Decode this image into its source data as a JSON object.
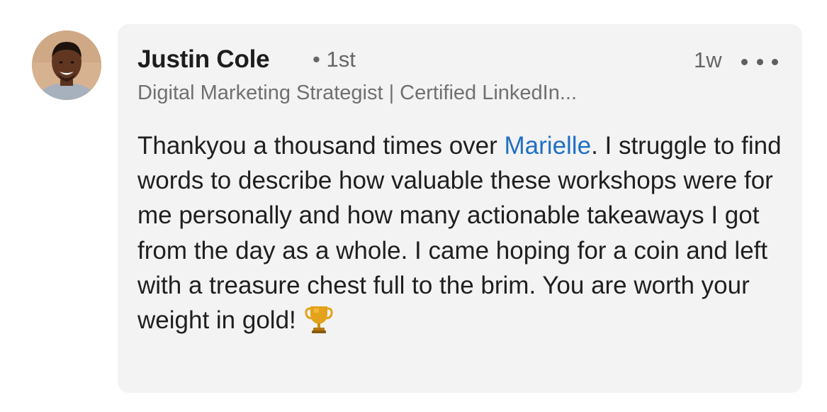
{
  "comment": {
    "author_name": "Justin Cole",
    "connection_degree": "• 1st",
    "timestamp": "1w",
    "headline": "Digital Marketing Strategist | Certified LinkedIn...",
    "message_before_mention": "Thankyou a thousand times over ",
    "mention": "Marielle",
    "message_after_mention": ". I struggle to find words to describe how valuable these workshops were for me personally and how many actionable takeaways I got from the day as a whole. I came hoping for a coin and left with a treasure chest full to the brim. You are worth your weight in gold!",
    "emoji_icon": "trophy-icon",
    "more_icon": "more-options-icon"
  },
  "colors": {
    "bubble_bg": "#f3f3f3",
    "mention": "#1f6fc5",
    "secondary_text": "#666666",
    "primary_text": "#1f1f1f"
  }
}
